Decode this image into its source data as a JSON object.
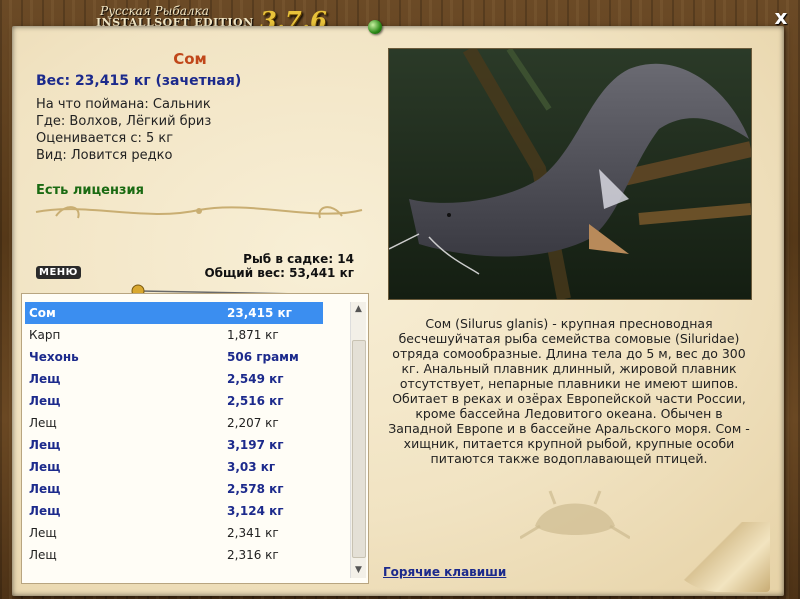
{
  "window": {
    "title_line1": "Русская Рыбалка",
    "title_line2": "INSTALLSOFT EDITION",
    "version": "3.7.6",
    "close_label": "x"
  },
  "fish": {
    "name": "Сом",
    "weight": "Вес: 23,415 кг (зачетная)",
    "bait": "На что поймана: Сальник",
    "location": "Где: Волхов, Лёгкий бриз",
    "rated_from": "Оценивается с: 5 кг",
    "rarity": "Вид: Ловится редко",
    "license": "Есть лицензия"
  },
  "keepnet": {
    "count": "Рыб в садке: 14",
    "total_weight": "Общий вес: 53,441 кг"
  },
  "menu_label": "МЕНЮ",
  "catch_list": [
    {
      "name": "Сом",
      "weight": "23,415 кг",
      "bold": true,
      "selected": true
    },
    {
      "name": "Карп",
      "weight": "1,871 кг",
      "bold": false,
      "selected": false
    },
    {
      "name": "Чехонь",
      "weight": "506 грамм",
      "bold": true,
      "selected": false
    },
    {
      "name": "Лещ",
      "weight": "2,549 кг",
      "bold": true,
      "selected": false
    },
    {
      "name": "Лещ",
      "weight": "2,516 кг",
      "bold": true,
      "selected": false
    },
    {
      "name": "Лещ",
      "weight": "2,207 кг",
      "bold": false,
      "selected": false
    },
    {
      "name": "Лещ",
      "weight": "3,197 кг",
      "bold": true,
      "selected": false
    },
    {
      "name": "Лещ",
      "weight": "3,03 кг",
      "bold": true,
      "selected": false
    },
    {
      "name": "Лещ",
      "weight": "2,578 кг",
      "bold": true,
      "selected": false
    },
    {
      "name": "Лещ",
      "weight": "3,124 кг",
      "bold": true,
      "selected": false
    },
    {
      "name": "Лещ",
      "weight": "2,341 кг",
      "bold": false,
      "selected": false
    },
    {
      "name": "Лещ",
      "weight": "2,316 кг",
      "bold": false,
      "selected": false
    }
  ],
  "description": "Сом (Silurus glanis) - крупная пресноводная бесчешуйчатая рыба семейства сомовые (Siluridae) отряда сомообразные. Длина тела до 5 м, вес до 300 кг. Анальный плавник длинный, жировой плавник отсутствует, непарные плавники не имеют шипов. Обитает в реках и озёрах Европейской части России, кроме бассейна Ледовитого океана. Обычен в Западной Европе и в бассейне Аральского моря. Сом - хищник, питается крупной рыбой, крупные особи питаются также водоплавающей птицей.",
  "hotkeys_label": "Горячие клавиши",
  "colors": {
    "accent_name": "#c0471a",
    "highlight_blue": "#1c2a8c",
    "license_green": "#1a6a12",
    "selection": "#3b8ef0",
    "paper": "#f1e3c2"
  }
}
